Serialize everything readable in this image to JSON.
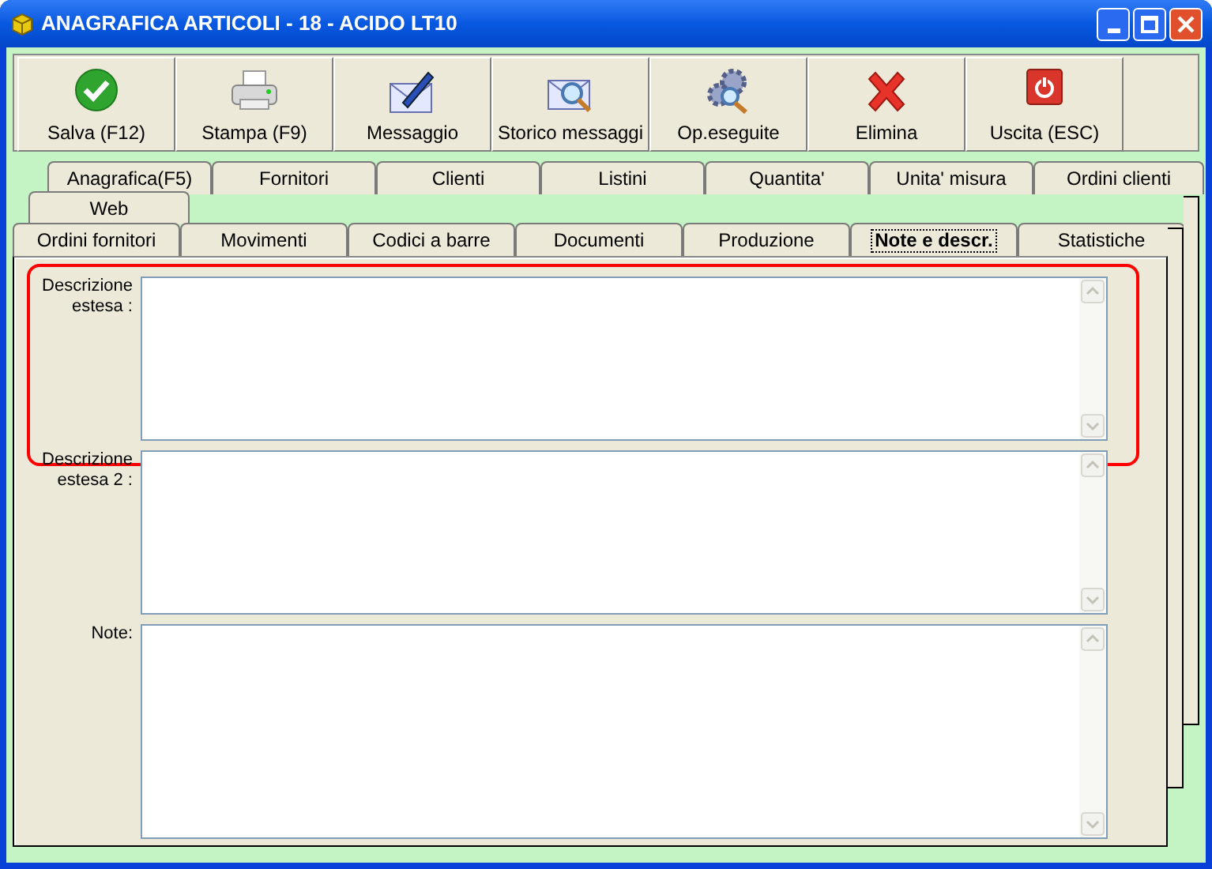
{
  "window": {
    "title": "ANAGRAFICA ARTICOLI - 18 - ACIDO LT10"
  },
  "toolbar": [
    {
      "label": "Salva (F12)",
      "kind": "save"
    },
    {
      "label": "Stampa (F9)",
      "kind": "print"
    },
    {
      "label": "Messaggio",
      "kind": "message"
    },
    {
      "label": "Storico messaggi",
      "kind": "history"
    },
    {
      "label": "Op.eseguite",
      "kind": "operations"
    },
    {
      "label": "Elimina",
      "kind": "delete"
    },
    {
      "label": "Uscita (ESC)",
      "kind": "exit"
    }
  ],
  "tab_rows": [
    {
      "tabs": [
        {
          "label": "Anagrafica(F5)",
          "selected": false
        },
        {
          "label": "Fornitori",
          "selected": false
        },
        {
          "label": "Clienti",
          "selected": false
        },
        {
          "label": "Listini",
          "selected": false
        },
        {
          "label": "Quantita'",
          "selected": false
        },
        {
          "label": "Unita' misura",
          "selected": false
        },
        {
          "label": "Ordini clienti",
          "selected": false
        }
      ]
    },
    {
      "tabs": [
        {
          "label": "Web",
          "selected": false
        }
      ]
    },
    {
      "tabs": [
        {
          "label": "Ordini fornitori",
          "selected": false
        },
        {
          "label": "Movimenti",
          "selected": false
        },
        {
          "label": "Codici a barre",
          "selected": false
        },
        {
          "label": "Documenti",
          "selected": false
        },
        {
          "label": "Produzione",
          "selected": false
        },
        {
          "label": "Note e descr.",
          "selected": true
        },
        {
          "label": "Statistiche",
          "selected": false
        }
      ]
    }
  ],
  "fields": [
    {
      "label": "Descrizione estesa :",
      "highlighted": true
    },
    {
      "label": "Descrizione estesa 2 :",
      "highlighted": false
    },
    {
      "label": "Note:",
      "highlighted": false
    }
  ]
}
